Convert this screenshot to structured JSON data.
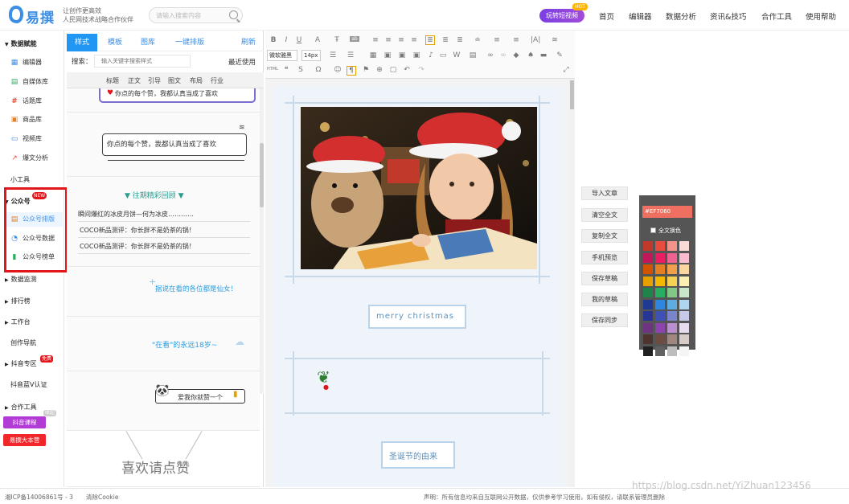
{
  "header": {
    "logo_text": "易撰",
    "slogan_line1": "让创作更高效",
    "slogan_line2": "人民网技术战略合作伙伴",
    "search_placeholder": "请输入搜索内容",
    "hot_button": "玩转短视频",
    "hot_badge": "HOT",
    "nav": [
      "首页",
      "编辑器",
      "数据分析",
      "资讯&技巧",
      "合作工具",
      "使用帮助"
    ]
  },
  "sidebar": {
    "section_data": "数据赋能",
    "data_items": [
      {
        "label": "编辑器",
        "icon": "grid-icon"
      },
      {
        "label": "自媒体库",
        "icon": "doc-icon"
      },
      {
        "label": "话题库",
        "icon": "hash-icon"
      },
      {
        "label": "商品库",
        "icon": "box-icon"
      },
      {
        "label": "视频库",
        "icon": "monitor-icon"
      },
      {
        "label": "爆文分析",
        "icon": "chart-icon"
      }
    ],
    "tools_heading": "小工具",
    "gzh_heading": "公众号",
    "new_badge": "NEW",
    "gzh_items": [
      {
        "label": "公众号排版",
        "icon": "layout-icon"
      },
      {
        "label": "公众号数据",
        "icon": "pie-icon"
      },
      {
        "label": "公众号榜单",
        "icon": "bars-icon"
      }
    ],
    "monitor": "数据监测",
    "ranking": "排行榜",
    "workbench": "工作台",
    "creation_nav": "创作导航",
    "douyin_zone": "抖音专区",
    "free_badge": "免费",
    "douyin_v": "抖音蓝V认证",
    "coop_tools": "合作工具",
    "collapse_badge": "收起",
    "douyin_course": "抖音课程",
    "yizhuan_camp": "易撰大本营"
  },
  "panel": {
    "tabs": [
      "样式",
      "模板",
      "图库",
      "一键排版",
      "刷新"
    ],
    "search_label": "搜索：",
    "search_placeholder": "输入关键字搜索样式",
    "recent": "最近使用",
    "categories": [
      "标题",
      "正文",
      "引导",
      "图文",
      "布局",
      "行业"
    ],
    "card1_text": "你点的每个赞，我都认真当成了喜欢",
    "card2_text": "你点的每个赞，我都认真当成了喜欢",
    "review_title": "往期精彩回顾",
    "review_items": [
      "瞬间爆红的冰皮月饼—何为冰皮…………",
      "COCO新品测评：你长胖不是奶茶的锅！",
      "COCO新品测评：你长胖不是奶茶的锅！"
    ],
    "fairy_text": "据说在看的各位都是仙女！",
    "forever_text": "\"在看\"的永远18岁~",
    "panda_text": "爱我你就赞一个",
    "like_text": "喜欢请点赞"
  },
  "toolbar": {
    "font_family": "微软雅黑",
    "font_size": "14px",
    "html_label": "HTML"
  },
  "editor": {
    "merry": "merry christmas",
    "origin": "圣诞节的由来"
  },
  "actions": [
    "导入文章",
    "清空全文",
    "复制全文",
    "手机预览",
    "保存草稿",
    "我的草稿",
    "保存同步"
  ],
  "palette": {
    "hex_value": "#EF7060",
    "full_text_label": "全文换色",
    "colors": [
      [
        "#c0392b",
        "#e74c3c",
        "#f1948a",
        "#fadbd8"
      ],
      [
        "#c2185b",
        "#e91e63",
        "#f06292",
        "#f8bbd0"
      ],
      [
        "#d35400",
        "#e67e22",
        "#f0a04b",
        "#fad7a0"
      ],
      [
        "#e6a100",
        "#f5b800",
        "#f7d154",
        "#fcefb4"
      ],
      [
        "#1e8449",
        "#27ae60",
        "#82c785",
        "#c8e6c9"
      ],
      [
        "#1f3a93",
        "#2e86de",
        "#5dade2",
        "#aed6f1"
      ],
      [
        "#283593",
        "#3f51b5",
        "#7986cb",
        "#c5cae9"
      ],
      [
        "#6c3483",
        "#8e44ad",
        "#bb8fce",
        "#e8daef"
      ],
      [
        "#4e342e",
        "#6d4c41",
        "#a1887f",
        "#d7ccc8"
      ],
      [
        "#212121",
        "#616161",
        "#bdbdbd",
        "#f5f5f5"
      ]
    ]
  },
  "footer": {
    "icp": "湘ICP备14006861号 - 3",
    "clear_cookie": "清除Cookie",
    "notice": "声明：所有信息均来自互联网公开数据，仅供参考学习使用，如有侵权，请联系管理员删除",
    "watermark": "https://blog.csdn.net/YiZhuan123456"
  }
}
